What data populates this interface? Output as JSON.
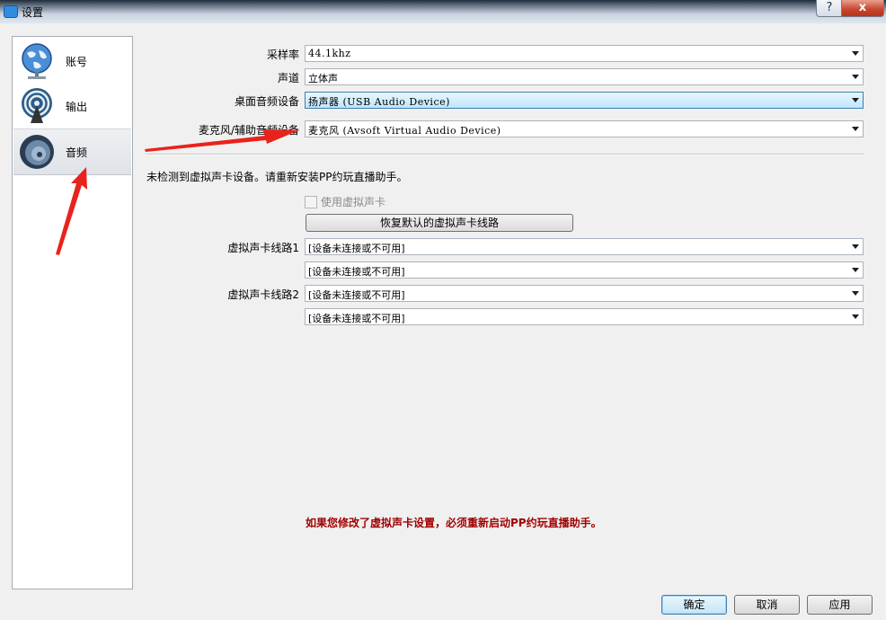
{
  "window": {
    "title": "设置",
    "help_glyph": "?",
    "close_glyph": "x"
  },
  "sidebar": {
    "items": [
      {
        "label": "账号",
        "icon": "globe-network-icon",
        "selected": false
      },
      {
        "label": "输出",
        "icon": "broadcast-antenna-icon",
        "selected": false
      },
      {
        "label": "音频",
        "icon": "speaker-icon",
        "selected": true
      }
    ]
  },
  "audio": {
    "sample_rate_label": "采样率",
    "sample_rate_value": "44.1khz",
    "channel_label": "声道",
    "channel_value": "立体声",
    "desktop_device_label": "桌面音频设备",
    "desktop_device_value": "扬声器 (USB Audio Device)",
    "mic_device_label": "麦克风/辅助音频设备",
    "mic_device_value": "麦克风 (Avsoft Virtual Audio Device)"
  },
  "virtual_card": {
    "notice": "未检测到虚拟声卡设备。请重新安装PP约玩直播助手。",
    "use_virtual_card_label": "使用虚拟声卡",
    "restore_button": "恢复默认的虚拟声卡线路",
    "line1_label": "虚拟声卡线路1",
    "line1_a": "[设备未连接或不可用]",
    "line1_b": "[设备未连接或不可用]",
    "line2_label": "虚拟声卡线路2",
    "line2_a": "[设备未连接或不可用]",
    "line2_b": "[设备未连接或不可用]"
  },
  "warning": "如果您修改了虚拟声卡设置，必须重新启动PP约玩直播助手。",
  "buttons": {
    "ok": "确定",
    "cancel": "取消",
    "apply": "应用"
  },
  "colors": {
    "accent": "#3c7fb1",
    "warning": "#a10000",
    "annotation_arrow": "#e8231c"
  }
}
